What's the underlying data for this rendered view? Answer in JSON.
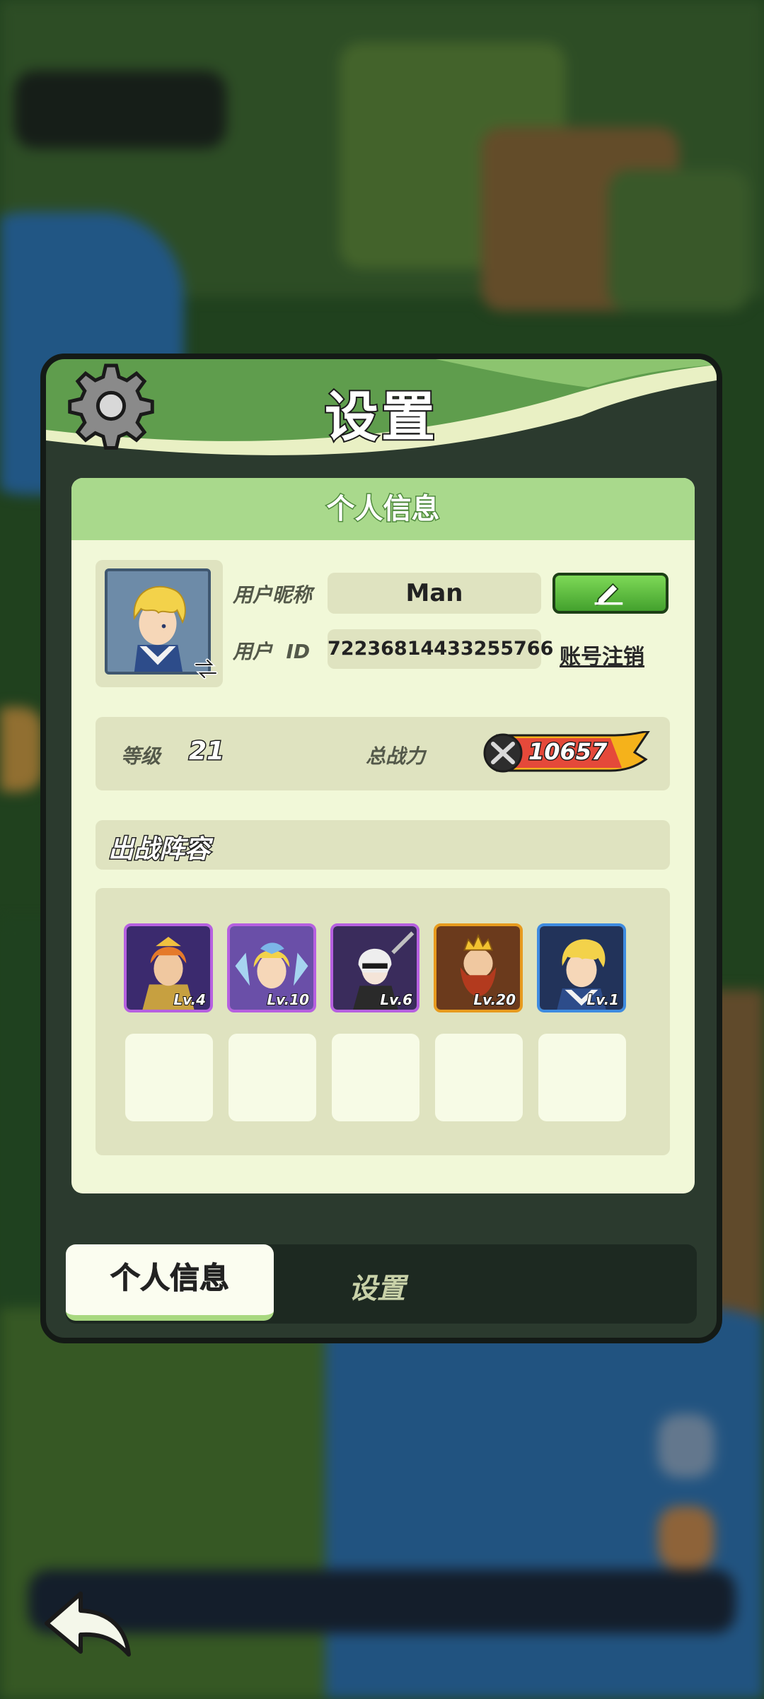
{
  "panel": {
    "title": "设置",
    "section_title": "个人信息"
  },
  "profile": {
    "nickname_label": "用户昵称",
    "nickname": "Man",
    "id_label": "用户  ID",
    "user_id": "72236814433255766",
    "account_cancel_label": "账号注销"
  },
  "stats": {
    "level_label": "等级",
    "level": "21",
    "power_label": "总战力",
    "power": "10657"
  },
  "lineup": {
    "title": "出战阵容",
    "heroes": [
      {
        "level": "Lv.4",
        "frame": "#a555d8",
        "bg": "#3b2a6e"
      },
      {
        "level": "Lv.10",
        "frame": "#a555d8",
        "bg": "#6a4fa8"
      },
      {
        "level": "Lv.6",
        "frame": "#a555d8",
        "bg": "#3a2c5c"
      },
      {
        "level": "Lv.20",
        "frame": "#e79b1e",
        "bg": "#6b3a1c"
      },
      {
        "level": "Lv.1",
        "frame": "#3e8be0",
        "bg": "#22335a"
      }
    ],
    "empty_slots": 5
  },
  "tabs": {
    "active": "个人信息",
    "inactive": "设置"
  },
  "colors": {
    "header_green": "#5f9d4d",
    "edit_button": "#43a12d",
    "card_bg": "#f1f8d8"
  }
}
